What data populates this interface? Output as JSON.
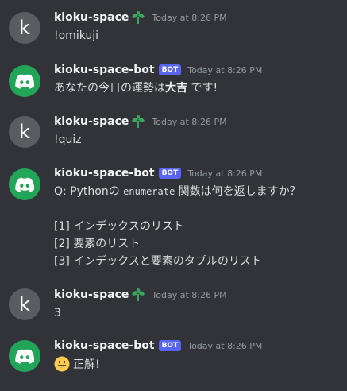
{
  "user": {
    "name": "kioku-space",
    "avatar_letter": "k"
  },
  "bot": {
    "name": "kioku-space-bot",
    "tag": "BOT"
  },
  "colors": {
    "background": "#313338",
    "bot_avatar": "#23a559",
    "user_avatar": "#5a5c61",
    "bot_tag": "#5865f2"
  },
  "messages": [
    {
      "timestamp": "Today at 8:26 PM",
      "text": "!omikuji"
    },
    {
      "timestamp": "Today at 8:26 PM",
      "text_before": "あなたの今日の運勢は",
      "text_bold": "大吉",
      "text_after": "です!"
    },
    {
      "timestamp": "Today at 8:26 PM",
      "text": "!quiz"
    },
    {
      "timestamp": "Today at 8:26 PM",
      "q_prefix": "Q: Pythonの",
      "q_code": "enumerate",
      "q_suffix": "関数は何を返しますか？",
      "options": [
        "[1] インデックスのリスト",
        "[2] 要素のリスト",
        "[3] インデックスと要素のタプルのリスト"
      ]
    },
    {
      "timestamp": "Today at 8:26 PM",
      "text": "3"
    },
    {
      "timestamp": "Today at 8:26 PM",
      "emoji": "smiley-emoji",
      "text": "正解!"
    }
  ]
}
